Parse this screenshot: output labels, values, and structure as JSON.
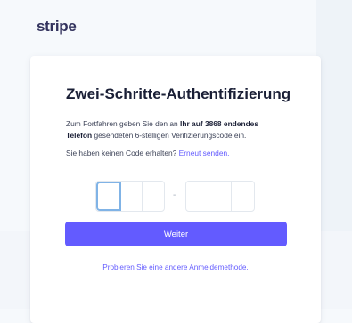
{
  "brand": {
    "logo": "stripe"
  },
  "card": {
    "title": "Zwei-Schritte-Authentifizierung",
    "desc_part1": "Zum Fortfahren geben Sie den an ",
    "desc_bold1": "Ihr auf 3868 endendes",
    "desc_bold2": "Telefon",
    "desc_part2": " gesendeten 6-stelligen Verifizierungscode ein.",
    "no_code_text": "Sie haben keinen Code erhalten? ",
    "resend_link": "Erneut senden.",
    "code_separator": "-",
    "submit_label": "Weiter",
    "alt_method_link": "Probieren Sie eine andere Anmeldemethode."
  },
  "colors": {
    "accent": "#635bff",
    "background": "#f6f9fc",
    "title": "#1a1f36",
    "text": "#3c4257"
  }
}
